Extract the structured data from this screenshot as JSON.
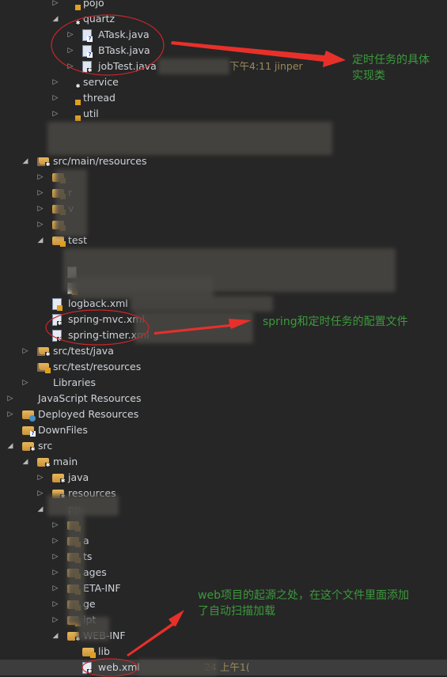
{
  "tree": [
    {
      "label": "pojo",
      "depth": 3,
      "toggle": "collapsed",
      "icon": "package",
      "badge": "lock"
    },
    {
      "label": "quartz",
      "depth": 3,
      "toggle": "expanded",
      "icon": "package",
      "badge": "star"
    },
    {
      "label": "ATask.java",
      "depth": 4,
      "toggle": "collapsed",
      "icon": "java",
      "badge": "q"
    },
    {
      "label": "BTask.java",
      "depth": 4,
      "toggle": "collapsed",
      "icon": "java",
      "badge": "q"
    },
    {
      "label": "jobTest.java",
      "depth": 4,
      "toggle": "collapsed",
      "icon": "java",
      "badge": "star",
      "meta": "下午4:11  jinper"
    },
    {
      "label": "service",
      "depth": 3,
      "toggle": "collapsed",
      "icon": "package",
      "badge": "star"
    },
    {
      "label": "thread",
      "depth": 3,
      "toggle": "collapsed",
      "icon": "package",
      "badge": "lock"
    },
    {
      "label": "util",
      "depth": 3,
      "toggle": "collapsed",
      "icon": "package",
      "badge": "lock"
    },
    {
      "label": "",
      "depth": 3,
      "toggle": "none",
      "icon": "none"
    },
    {
      "label": "",
      "depth": 3,
      "toggle": "none",
      "icon": "none"
    },
    {
      "label": "src/main/resources",
      "depth": 1,
      "toggle": "expanded",
      "icon": "srcfolder",
      "badge": "star"
    },
    {
      "label": "",
      "depth": 2,
      "toggle": "collapsed",
      "icon": "folder",
      "badge": "lock"
    },
    {
      "label": "r",
      "depth": 2,
      "toggle": "collapsed",
      "icon": "folder",
      "badge": "lock"
    },
    {
      "label": "v",
      "depth": 2,
      "toggle": "collapsed",
      "icon": "folder",
      "badge": "lock"
    },
    {
      "label": "",
      "depth": 2,
      "toggle": "collapsed",
      "icon": "folder",
      "badge": "lock"
    },
    {
      "label": "test",
      "depth": 2,
      "toggle": "expanded",
      "icon": "folder",
      "badge": "lock"
    },
    {
      "label": "",
      "depth": 3,
      "toggle": "none",
      "icon": "none"
    },
    {
      "label": "",
      "depth": 3,
      "toggle": "none",
      "icon": "xml"
    },
    {
      "label": "",
      "depth": 3,
      "toggle": "none",
      "icon": "xml",
      "badge": "lock"
    },
    {
      "label": "logback.xml",
      "depth": 2,
      "toggle": "none",
      "icon": "xml",
      "badge": "lock"
    },
    {
      "label": "spring-mvc.xml",
      "depth": 2,
      "toggle": "none",
      "icon": "xml",
      "badge": "star"
    },
    {
      "label": "spring-timer.xml",
      "depth": 2,
      "toggle": "none",
      "icon": "xml",
      "badge": "star"
    },
    {
      "label": "src/test/java",
      "depth": 1,
      "toggle": "collapsed",
      "icon": "srcfolder",
      "badge": "star"
    },
    {
      "label": "src/test/resources",
      "depth": 1,
      "toggle": "none",
      "icon": "srcfolder",
      "badge": "lock"
    },
    {
      "label": "Libraries",
      "depth": 1,
      "toggle": "collapsed",
      "icon": "library"
    },
    {
      "label": "JavaScript Resources",
      "depth": 0,
      "toggle": "collapsed",
      "icon": "library"
    },
    {
      "label": "Deployed Resources",
      "depth": 0,
      "toggle": "collapsed",
      "icon": "deploy"
    },
    {
      "label": "DownFiles",
      "depth": 0,
      "toggle": "none",
      "icon": "folder",
      "badge": "q"
    },
    {
      "label": "src",
      "depth": 0,
      "toggle": "expanded",
      "icon": "folder",
      "badge": "star"
    },
    {
      "label": "main",
      "depth": 1,
      "toggle": "expanded",
      "icon": "folder",
      "badge": "star"
    },
    {
      "label": "java",
      "depth": 2,
      "toggle": "collapsed",
      "icon": "folder",
      "badge": "star"
    },
    {
      "label": "resources",
      "depth": 2,
      "toggle": "collapsed",
      "icon": "folder",
      "badge": "star"
    },
    {
      "label": "pp",
      "depth": 2,
      "toggle": "expanded",
      "icon": "none"
    },
    {
      "label": "",
      "depth": 3,
      "toggle": "collapsed",
      "icon": "folder",
      "badge": "lock"
    },
    {
      "label": "a",
      "depth": 3,
      "toggle": "collapsed",
      "icon": "folder",
      "badge": "lock"
    },
    {
      "label": "ts",
      "depth": 3,
      "toggle": "collapsed",
      "icon": "folder",
      "badge": "lock"
    },
    {
      "label": "ages",
      "depth": 3,
      "toggle": "collapsed",
      "icon": "folder",
      "badge": "lock"
    },
    {
      "label": "ETA-INF",
      "depth": 3,
      "toggle": "collapsed",
      "icon": "folder",
      "badge": "lock"
    },
    {
      "label": "ge",
      "depth": 3,
      "toggle": "collapsed",
      "icon": "folder",
      "badge": "lock"
    },
    {
      "label": "ipt",
      "depth": 3,
      "toggle": "collapsed",
      "icon": "folder",
      "badge": "lock"
    },
    {
      "label": "WEB-INF",
      "depth": 3,
      "toggle": "expanded",
      "icon": "folder",
      "badge": "star"
    },
    {
      "label": "lib",
      "depth": 4,
      "toggle": "none",
      "icon": "folder",
      "badge": "lock"
    },
    {
      "label": "web.xml",
      "depth": 4,
      "toggle": "none",
      "icon": "xml",
      "badge": "star",
      "selected": true,
      "meta": "24  上午1("
    }
  ],
  "annotations": {
    "quartz_note": "定时任务的具体\n实现类",
    "spring_note": "spring和定时任务的配置文件",
    "web_note": "web项目的起源之处，在这个文件里面添加\n了自动扫描加载"
  },
  "colors": {
    "background": "#262626",
    "annotation_text": "#3c9a3c",
    "annotation_marks": "#e8302a",
    "selected_row": "#3d3d3d"
  }
}
